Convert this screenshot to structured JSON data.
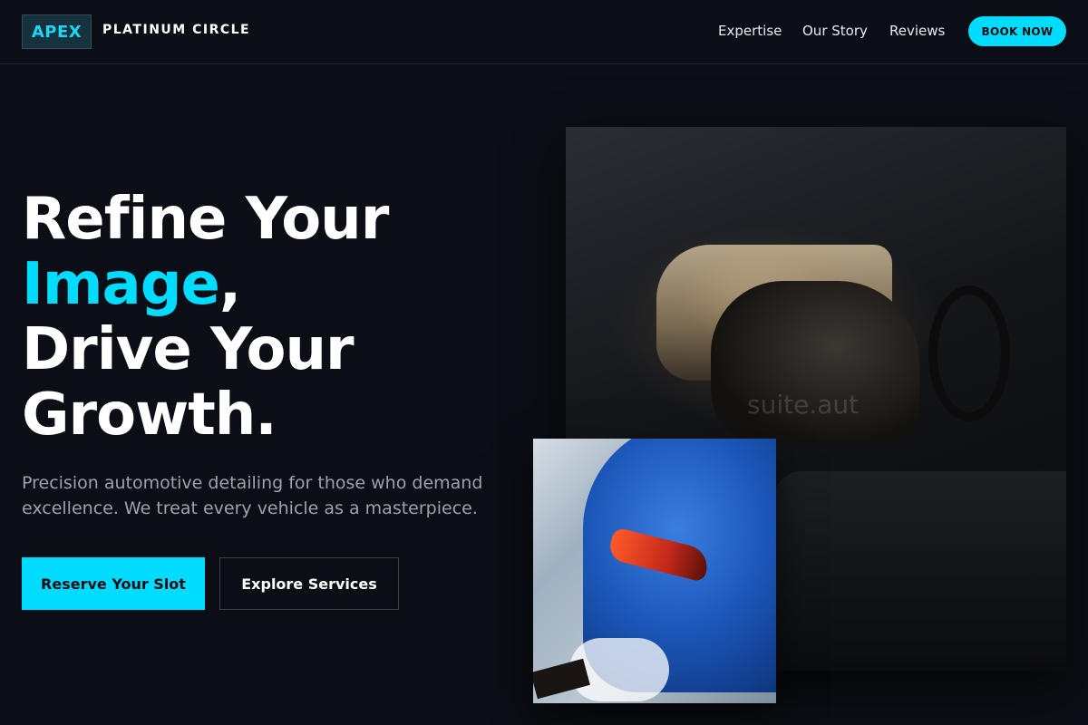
{
  "nav": {
    "logo": "APEX",
    "brand": "PLATINUM CIRCLE",
    "links": [
      "Expertise",
      "Our Story",
      "Reviews"
    ],
    "cta": "BOOK NOW"
  },
  "hero": {
    "headline_line1": "Refine Your",
    "headline_accent": "Image",
    "headline_comma": ",",
    "headline_line3": "Drive Your",
    "headline_line4": "Growth.",
    "subtext": "Precision automotive detailing for those who demand excellence. We treat every vehicle as a masterpiece.",
    "primary_button": "Reserve Your Slot",
    "secondary_button": "Explore Services"
  },
  "images": {
    "main_watermark": "suite.aut"
  },
  "colors": {
    "accent": "#00dcff",
    "background": "#0b0e14"
  }
}
